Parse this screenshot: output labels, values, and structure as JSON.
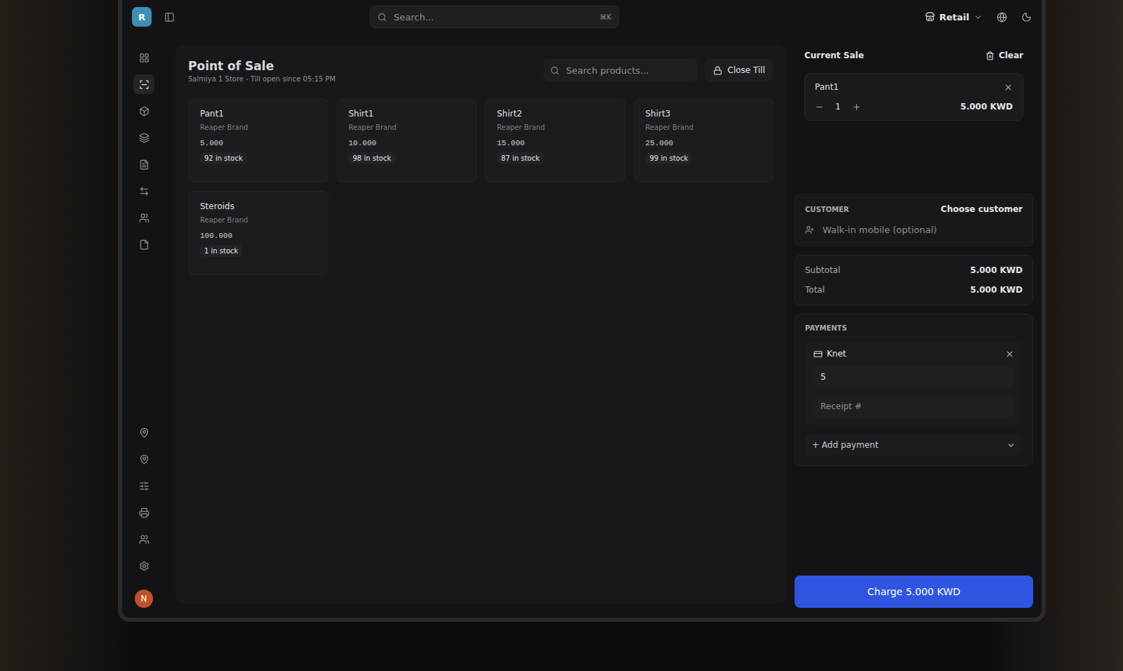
{
  "app": {
    "logo": "R",
    "search_placeholder": "Search...",
    "shortcut": "⌘K",
    "store": "Retail",
    "avatar": "N"
  },
  "nav_top": [
    {
      "selected": false
    },
    {
      "selected": true
    },
    {
      "selected": false
    },
    {
      "selected": false
    },
    {
      "selected": false
    },
    {
      "selected": false
    },
    {
      "selected": false
    },
    {
      "selected": false
    }
  ],
  "nav_bottom": [
    {
      "selected": false
    },
    {
      "selected": false
    },
    {
      "selected": false
    },
    {
      "selected": false
    },
    {
      "selected": false
    },
    {
      "selected": false
    }
  ],
  "page": {
    "title": "Point of Sale",
    "subtitle": "Salmiya 1 Store - Till open since 05:15 PM",
    "search_placeholder": "Search products...",
    "close_till": "Close Till"
  },
  "products": [
    {
      "name": "Pant1",
      "brand": "Reaper Brand",
      "price": "5.000",
      "stock": "92 in stock"
    },
    {
      "name": "Shirt1",
      "brand": "Reaper Brand",
      "price": "10.000",
      "stock": "98 in stock"
    },
    {
      "name": "Shirt2",
      "brand": "Reaper Brand",
      "price": "15.000",
      "stock": "87 in stock"
    },
    {
      "name": "Shirt3",
      "brand": "Reaper Brand",
      "price": "25.000",
      "stock": "99 in stock"
    },
    {
      "name": "Steroids",
      "brand": "Reaper Brand",
      "price": "100.000",
      "stock": "1 in stock"
    }
  ],
  "sale": {
    "title": "Current Sale",
    "clear": "Clear",
    "items": [
      {
        "name": "Pant1",
        "qty": "1",
        "price": "5.000 KWD"
      }
    ]
  },
  "customer": {
    "label": "CUSTOMER",
    "action": "Choose customer",
    "placeholder": "Walk-in mobile (optional)"
  },
  "totals": [
    {
      "label": "Subtotal",
      "value": "5.000 KWD"
    },
    {
      "label": "Total",
      "value": "5.000 KWD"
    }
  ],
  "payments": {
    "label": "PAYMENTS",
    "entries": [
      {
        "method": "Knet",
        "amount": "5",
        "receipt_placeholder": "Receipt #"
      }
    ],
    "add": "+ Add payment"
  },
  "charge": "Charge 5.000 KWD"
}
